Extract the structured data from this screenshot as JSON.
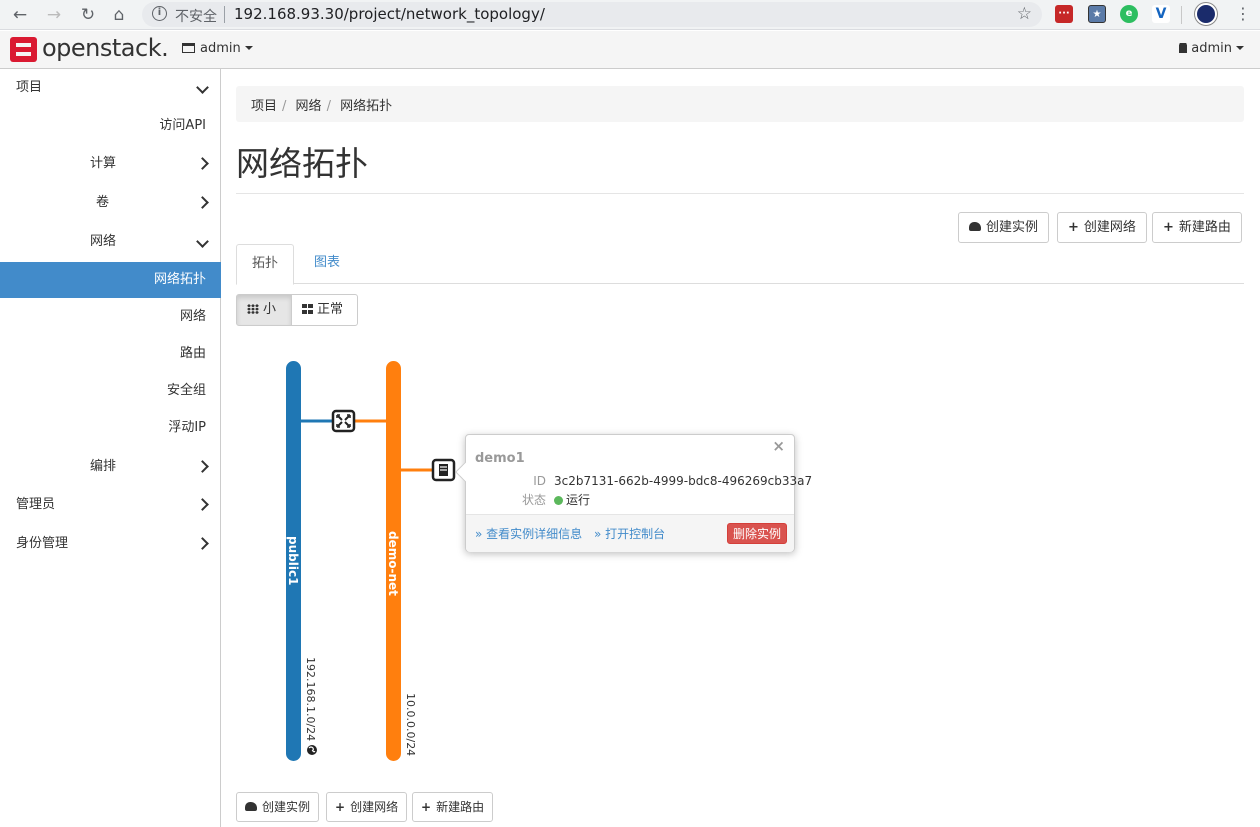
{
  "browser": {
    "insecure_label": "不安全",
    "url": "192.168.93.30/project/network_topology/"
  },
  "navbar": {
    "logo": "openstack.",
    "project": "admin",
    "user": "admin"
  },
  "sidebar": {
    "items": [
      {
        "label": "项目",
        "chevron": "down"
      },
      {
        "label": "访问API"
      },
      {
        "label": "计算",
        "chevron": "right"
      },
      {
        "label": "卷",
        "chevron": "right"
      },
      {
        "label": "网络",
        "chevron": "down"
      },
      {
        "label": "网络拓扑",
        "active": true
      },
      {
        "label": "网络"
      },
      {
        "label": "路由"
      },
      {
        "label": "安全组"
      },
      {
        "label": "浮动IP"
      },
      {
        "label": "编排",
        "chevron": "right"
      },
      {
        "label": "管理员",
        "chevron": "right"
      },
      {
        "label": "身份管理",
        "chevron": "right"
      }
    ]
  },
  "breadcrumb": [
    "项目",
    "网络",
    "网络拓扑"
  ],
  "page_title": "网络拓扑",
  "actions": {
    "launch_instance": "创建实例",
    "create_network": "创建网络",
    "create_router": "新建路由"
  },
  "tabs": {
    "topology": "拓扑",
    "graph": "图表"
  },
  "size_toggle": {
    "small": "小",
    "normal": "正常"
  },
  "topology": {
    "networks": [
      {
        "name": "public1",
        "cidr": "192.168.1.0/24",
        "color": "#1f77b4",
        "external": true
      },
      {
        "name": "demo-net",
        "cidr": "10.0.0.0/24",
        "color": "#ff7f0e"
      }
    ],
    "router_icon": "router-icon",
    "instance_icon": "server-icon"
  },
  "popup": {
    "title": "demo1",
    "id_label": "ID",
    "id_value": "3c2b7131-662b-4999-bdc8-496269cb33a7",
    "status_label": "状态",
    "status_value": "运行",
    "status_color": "#5cb85c",
    "detail_link": "» 查看实例详细信息",
    "console_link": "» 打开控制台",
    "delete_button": "删除实例",
    "close": "×"
  },
  "colors": {
    "accent": "#428bca",
    "danger": "#d9534f",
    "brand_red": "#da1a32"
  }
}
